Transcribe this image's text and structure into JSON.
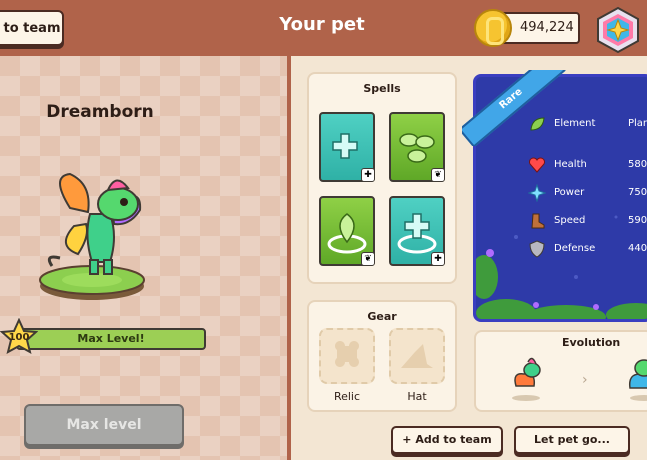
{
  "header": {
    "back_label": "to team",
    "title": "Your pet",
    "coins": "494,224"
  },
  "pet": {
    "name": "Dreamborn",
    "level": "100",
    "level_status": "Max Level!",
    "level_progress": 1.0,
    "max_button_label": "Max level"
  },
  "spells": {
    "title": "Spells",
    "items": [
      {
        "icon": "heal-cross-icon",
        "style": "teal",
        "tag": "heal-tag-icon"
      },
      {
        "icon": "leaf-burst-icon",
        "style": "green",
        "tag": "leaf-tag-icon"
      },
      {
        "icon": "leaf-shield-icon",
        "style": "green",
        "tag": "leaf-tag-icon"
      },
      {
        "icon": "heal-aura-icon",
        "style": "teal",
        "tag": "heal-tag-icon"
      }
    ]
  },
  "gear": {
    "title": "Gear",
    "slots": [
      {
        "label": "Relic",
        "icon": "relic-icon"
      },
      {
        "label": "Hat",
        "icon": "hat-icon"
      }
    ]
  },
  "stats": {
    "rarity": "Rare",
    "rows": [
      {
        "label": "Element",
        "value": "Plan",
        "icon": "leaf-icon"
      },
      {
        "label": "Health",
        "value": "580",
        "icon": "heart-icon"
      },
      {
        "label": "Power",
        "value": "750",
        "icon": "spark-icon"
      },
      {
        "label": "Speed",
        "value": "590",
        "icon": "boot-icon"
      },
      {
        "label": "Defense",
        "value": "440",
        "icon": "shield-icon"
      }
    ]
  },
  "evolution": {
    "title": "Evolution"
  },
  "actions": {
    "add_to_team": "+ Add to team",
    "let_go": "Let pet go..."
  },
  "colors": {
    "header": "#b0634a",
    "rare_blue": "#41a6e8",
    "stats_bg": "#2e3aa8",
    "max_level_bar": "#9ccf55"
  }
}
